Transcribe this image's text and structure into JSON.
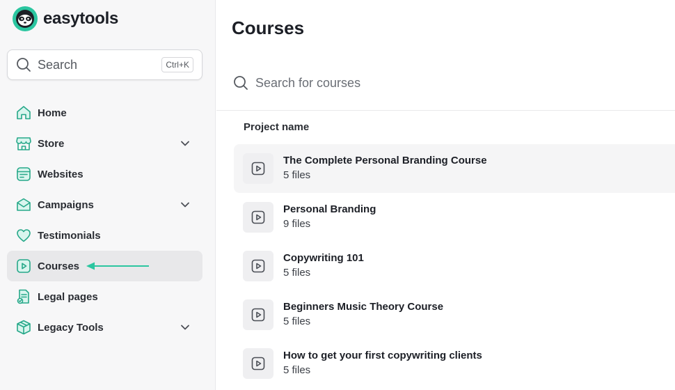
{
  "brand": {
    "name": "easytools",
    "accent": "#2bc6a0"
  },
  "search": {
    "placeholder": "Search",
    "shortcut": "Ctrl+K"
  },
  "sidebar": {
    "items": [
      {
        "label": "Home",
        "icon": "home-icon"
      },
      {
        "label": "Store",
        "icon": "store-icon",
        "expandable": true
      },
      {
        "label": "Websites",
        "icon": "websites-icon"
      },
      {
        "label": "Campaigns",
        "icon": "campaigns-icon",
        "expandable": true
      },
      {
        "label": "Testimonials",
        "icon": "heart-icon"
      },
      {
        "label": "Courses",
        "icon": "play-icon",
        "active": true
      },
      {
        "label": "Legal pages",
        "icon": "legal-icon"
      },
      {
        "label": "Legacy Tools",
        "icon": "box-icon",
        "expandable": true
      }
    ]
  },
  "main": {
    "title": "Courses",
    "search_placeholder": "Search for courses",
    "column_header": "Project name",
    "courses": [
      {
        "title": "The Complete Personal Branding Course",
        "files": "5 files"
      },
      {
        "title": "Personal Branding",
        "files": "9 files"
      },
      {
        "title": "Copywriting 101",
        "files": "5 files"
      },
      {
        "title": "Beginners Music Theory Course",
        "files": "5 files"
      },
      {
        "title": "How to get your first copywriting clients",
        "files": "5 files"
      }
    ]
  }
}
